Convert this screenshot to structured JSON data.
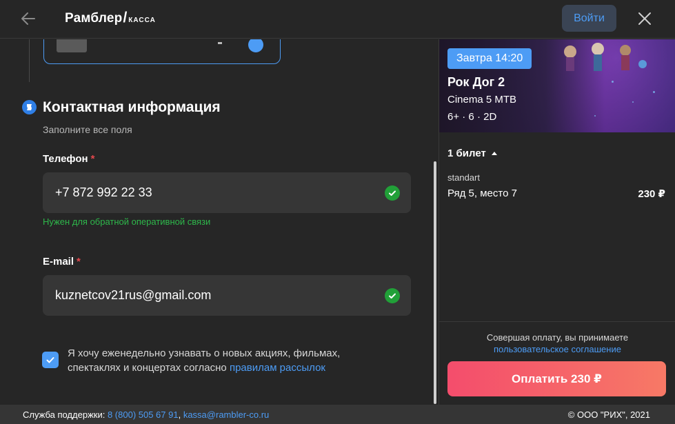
{
  "header": {
    "logo_main": "Рамблер",
    "logo_slash": "/",
    "logo_sub": "КАССА",
    "login_label": "Войти"
  },
  "contact": {
    "title": "Контактная информация",
    "subtitle": "Заполните все поля",
    "phone_label": "Телефон",
    "phone_value": "+7 872 992 22 33",
    "phone_hint": "Нужен для обратной оперативной связи",
    "email_label": "E-mail",
    "email_value": "kuznetcov21rus@gmail.com",
    "required_mark": "*",
    "consent_text": "Я хочу еженедельно узнавать о новых акциях, фильмах, спектаклях и концертах согласно ",
    "consent_link": "правилам рассылок",
    "consent_checked": true
  },
  "order": {
    "time_badge": "Завтра 14:20",
    "movie_title": "Рок Дог 2",
    "cinema": "Cinema 5 МТВ",
    "meta": "6+ · 6 · 2D",
    "tickets_toggle": "1 билет",
    "ticket_type": "standart",
    "seat": "Ряд 5, место 7",
    "price": "230 ₽",
    "agree_text": "Совершая оплату, вы принимаете",
    "agree_link": "пользовательское соглашение",
    "pay_label": "Оплатить 230 ₽"
  },
  "footer": {
    "support_label": "Служба поддержки:",
    "phone": "8 (800) 505 67 91",
    "separator": ", ",
    "email": "kassa@rambler-co.ru",
    "copyright": "© ООО \"РИХ\", 2021"
  },
  "colors": {
    "accent": "#4d9cf5",
    "success": "#21a038",
    "pay_gradient_start": "#f44d6c",
    "pay_gradient_end": "#f77966"
  }
}
